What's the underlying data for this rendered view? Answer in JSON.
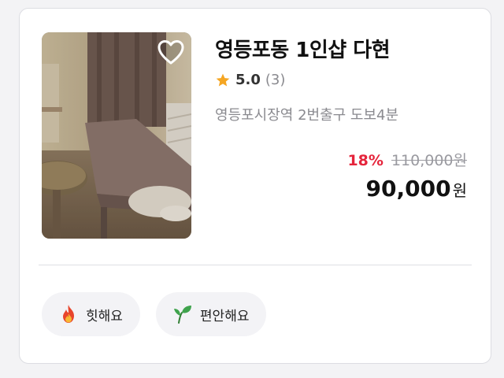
{
  "shop": {
    "title": "영등포동 1인샵 다현",
    "rating": "5.0",
    "review_count": "(3)",
    "location": "영등포시장역 2번출구 도보4분",
    "favorited": false
  },
  "price": {
    "discount": "18%",
    "original": "110,000원",
    "final": "90,000",
    "currency": "원"
  },
  "tags": [
    {
      "label": "힛해요",
      "icon": "fire-icon"
    },
    {
      "label": "편안해요",
      "icon": "leaf-icon"
    }
  ],
  "colors": {
    "discount": "#e5243b",
    "star": "#f5a623",
    "tag_bg": "#f3f3f6"
  }
}
